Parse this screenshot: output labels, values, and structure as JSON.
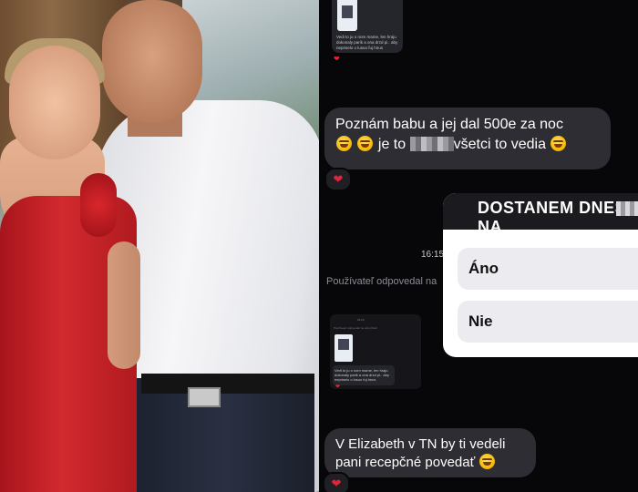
{
  "chat": {
    "top_preview_text": "Vedi to ju o nom mame, len hraju dokonaly parik a ona drzd pi.. aby nepriselo o lusuo fuj hnus",
    "message_1": {
      "line1": "Poznám babu a jej dal 500e za noc",
      "line2_a": "je to",
      "line2_b": "všetci to vedia"
    },
    "time": "16:15",
    "replied_label": "Používateľ odpovedal na",
    "mini_preview_time": "16:13",
    "mini_preview_label": "Používateľ odpovedal na váš príbeh",
    "mini_preview_text": "Vedi to ju o nom mame, len hraju dokonaly parik a ona drzd pi.. aby nepriselo o lusuo fuj hnus",
    "message_2": "V Elizabeth v TN by ti vedeli pani recepčné povedať",
    "reaction_icon": "heart-icon",
    "emoji_icon": "rofl-emoji-icon"
  },
  "poll": {
    "title": "DOSTANEM DNES NA",
    "options": [
      "Áno",
      "Nie"
    ]
  },
  "colors": {
    "chat_bg": "#07070a",
    "bubble": "#2d2d33",
    "heart": "#e3233a",
    "dress": "#d22a2e"
  }
}
